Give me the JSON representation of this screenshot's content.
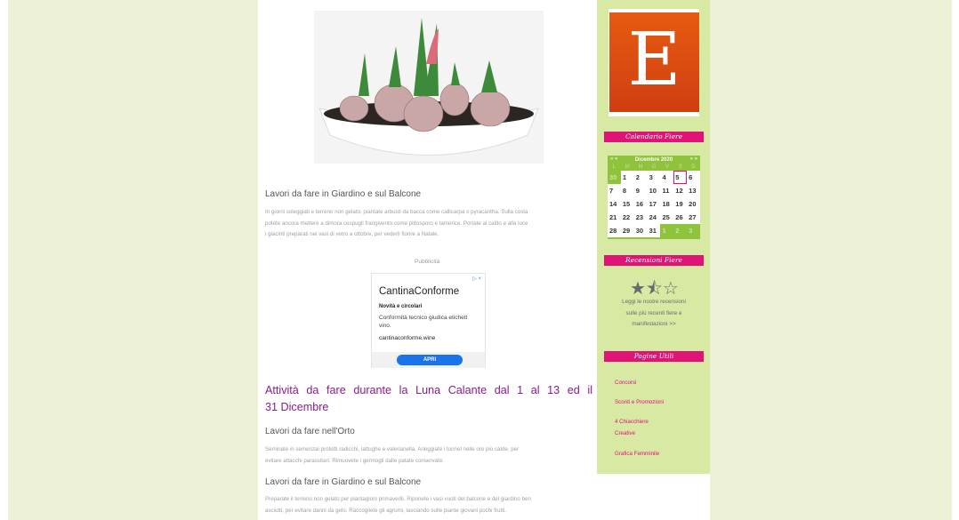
{
  "article": {
    "section1": {
      "heading": "Lavori da fare in Giardino e sul Balcone",
      "text_line1": "In giorni soleggiati e terreno non gelato, piantate arbusti da bacca come callicarpa o pyracantha. Sulla costa",
      "text_line2": "potete ancora mettere a dimora cespugli frangivento come pittosporo e tamerice. Portate al caldo e alla luce",
      "text_line3": "i giacinti preparati nei vasi di vetro a ottobre, per vederli fiorire a Natale."
    },
    "ad": {
      "label": "Pubblicità",
      "badge": "▷ ×",
      "title": "CantinaConforme",
      "headline": "Novità e circolari",
      "description_line1": "Conformità tecnico giudica etichett",
      "description_line2": "vino.",
      "url": "cantinaconforme.wine",
      "button": "APRI"
    },
    "main_heading_line1": "Attività da fare durante la Luna Calante dal 1 al 13 ed il",
    "main_heading_line2": "31 Dicembre",
    "section2": {
      "heading": "Lavori da fare nell'Orto",
      "text_line1": "Seminate in semenzai protetti radicchi, lattughe e valerianella. Arieggiate i tunnel nelle ore più calde, per",
      "text_line2": "evitare attacchi parassitari. Rimuovete i germogli dalle patate conservate."
    },
    "section3": {
      "heading": "Lavori da fare in Giardino e sul Balcone",
      "text_line1": "Preparate il terreno non gelato per piantagioni primaverili. Riponete i vasi vuoti del balcone e del giardino ben",
      "text_line2": "asciutti, per evitare danni da gelo. Raccogliete gli agrumi, lasciando sulle piante giovani pochi frutti."
    }
  },
  "sidebar": {
    "logo_letter": "E",
    "calendar": {
      "title": "Calendario Fiere",
      "prev": "« «",
      "month": "Dicembre 2020",
      "next": "» »",
      "weekdays": [
        "L",
        "M",
        "M",
        "G",
        "V",
        "S",
        "D"
      ],
      "weeks": [
        [
          {
            "d": "30",
            "o": true
          },
          {
            "d": "1"
          },
          {
            "d": "2"
          },
          {
            "d": "3"
          },
          {
            "d": "4"
          },
          {
            "d": "5",
            "t": true
          },
          {
            "d": "6"
          }
        ],
        [
          {
            "d": "7"
          },
          {
            "d": "8"
          },
          {
            "d": "9"
          },
          {
            "d": "10"
          },
          {
            "d": "11"
          },
          {
            "d": "12"
          },
          {
            "d": "13"
          }
        ],
        [
          {
            "d": "14"
          },
          {
            "d": "15"
          },
          {
            "d": "16"
          },
          {
            "d": "17"
          },
          {
            "d": "18"
          },
          {
            "d": "19"
          },
          {
            "d": "20"
          }
        ],
        [
          {
            "d": "21"
          },
          {
            "d": "22"
          },
          {
            "d": "23"
          },
          {
            "d": "24"
          },
          {
            "d": "25"
          },
          {
            "d": "26"
          },
          {
            "d": "27"
          }
        ],
        [
          {
            "d": "28"
          },
          {
            "d": "29"
          },
          {
            "d": "30"
          },
          {
            "d": "31"
          },
          {
            "d": "1",
            "o": true
          },
          {
            "d": "2",
            "o": true
          },
          {
            "d": "3",
            "o": true
          }
        ]
      ]
    },
    "reviews": {
      "title": "Recensioni Fiere",
      "stars": [
        "★",
        "⯪",
        "☆"
      ],
      "text_line1": "Leggi le nostre recensioni",
      "text_line2": "sulle più recenti fiere e",
      "text_line3": "manifestazioni >>"
    },
    "pages": {
      "title": "Pagine Utili",
      "links": [
        "Concorsi",
        "Sconti e Promozioni",
        "4 Chiacchiere",
        "Creative",
        "Grafica Femminile"
      ]
    }
  },
  "colors": {
    "accent": "#e01376",
    "heading": "#8b1a8b",
    "sidebar_bg": "#d8e9a4",
    "page_bg": "#edf2d6"
  }
}
